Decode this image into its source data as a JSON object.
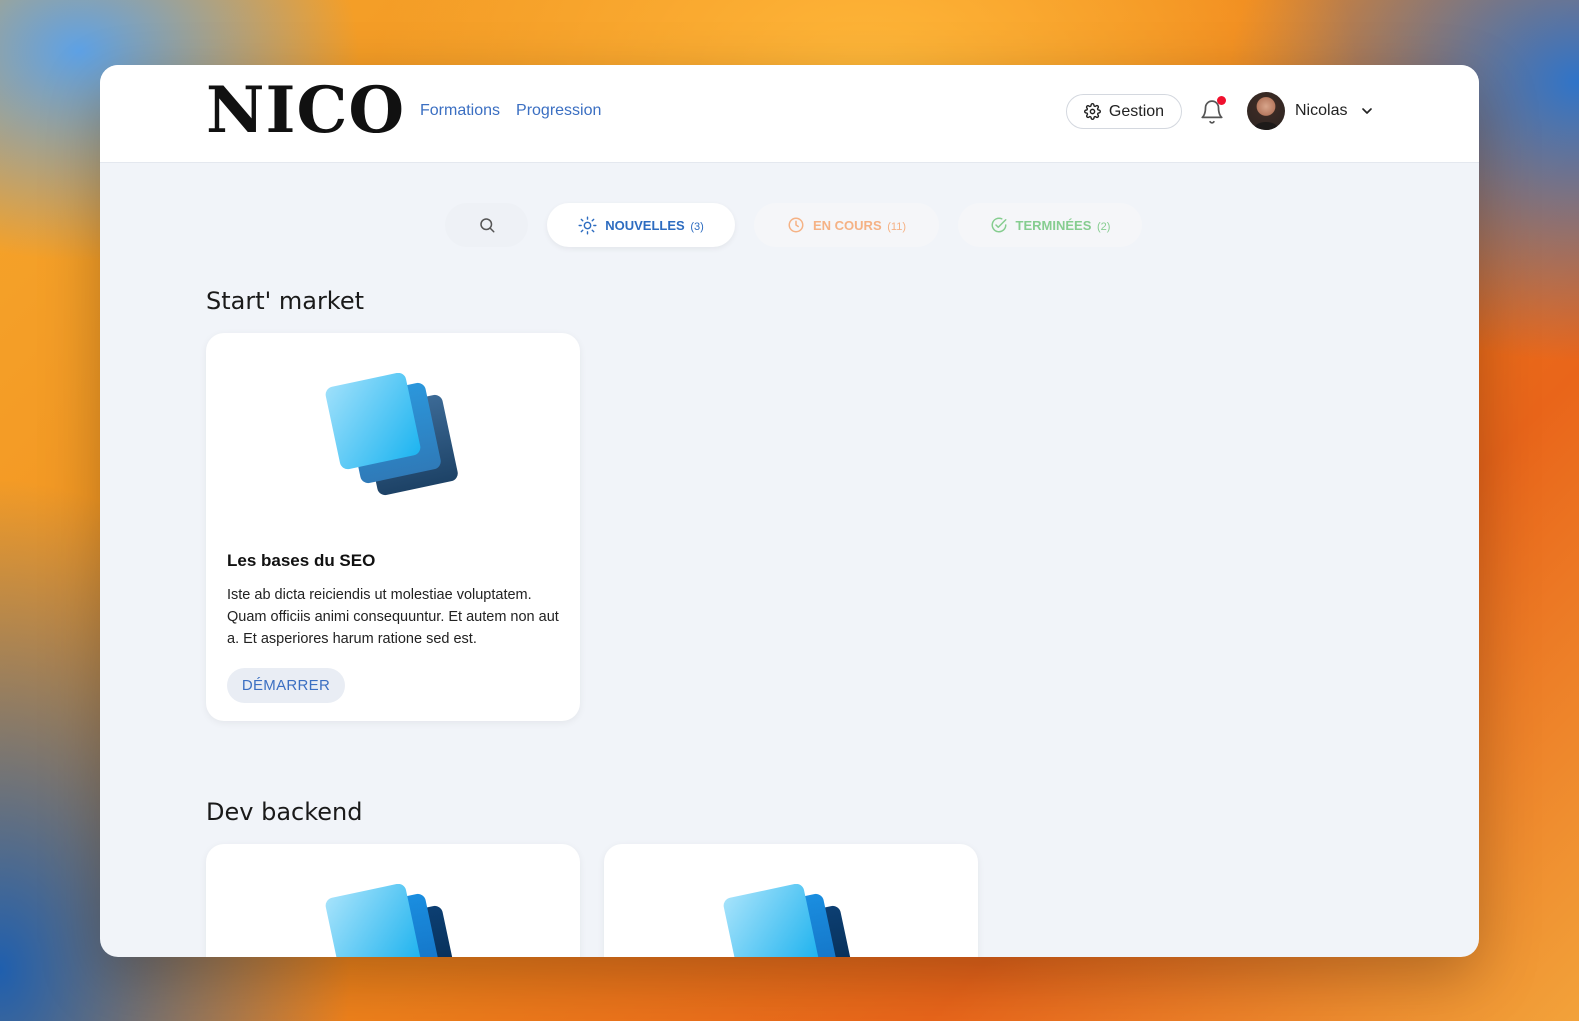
{
  "header": {
    "logo": "NICO",
    "nav": [
      "Formations",
      "Progression"
    ],
    "gestion_label": "Gestion",
    "user_name": "Nicolas"
  },
  "filters": {
    "new": {
      "label": "NOUVELLES",
      "count": "(3)"
    },
    "in_progress": {
      "label": "EN COURS",
      "count": "(11)"
    },
    "done": {
      "label": "TERMINÉES",
      "count": "(2)"
    }
  },
  "sections": [
    {
      "title": "Start' market",
      "cards": [
        {
          "title": "Les bases du SEO",
          "description": "Iste ab dicta reiciendis ut molestiae voluptatem. Quam officiis animi consequuntur. Et autem non aut a. Et asperiores harum ratione sed est.",
          "button": "DÉMARRER"
        }
      ]
    },
    {
      "title": "Dev backend"
    }
  ],
  "colors": {
    "accent": "#3b6fc2",
    "in_progress": "#f5b285",
    "done": "#86cd90",
    "notification": "#f0112e"
  },
  "icons": [
    "gear-icon",
    "bell-icon",
    "chevron-down-icon",
    "search-icon",
    "sun-icon",
    "clock-icon",
    "check-circle-icon",
    "layers-illustration"
  ]
}
